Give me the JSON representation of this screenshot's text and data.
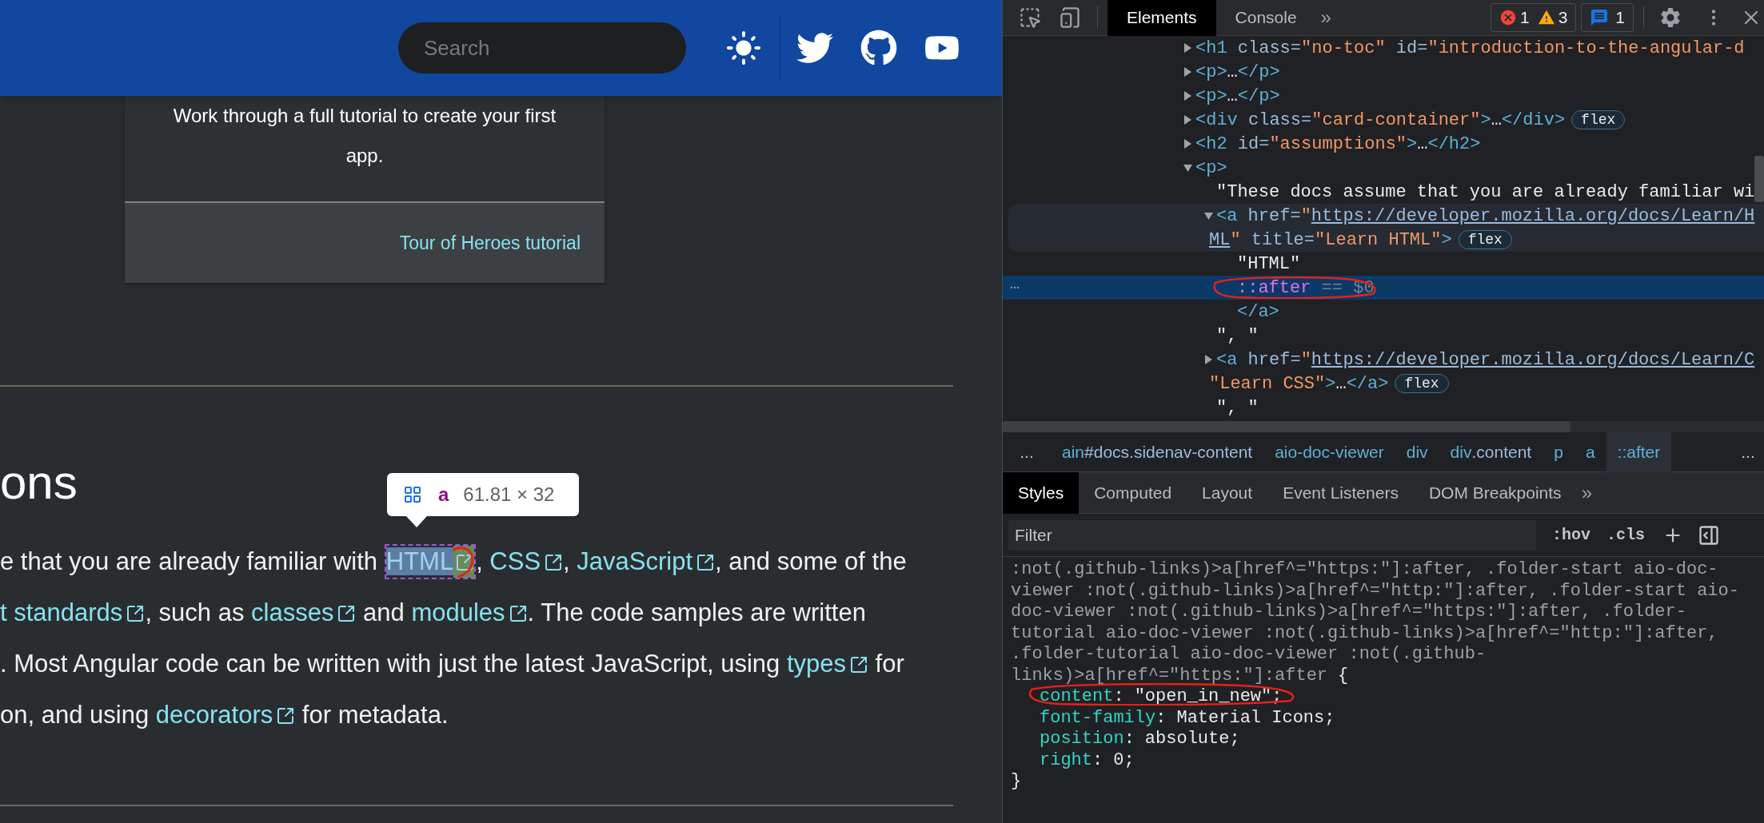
{
  "page": {
    "header": {
      "search": {
        "placeholder": "Search"
      }
    },
    "card": {
      "text": "Work through a full tutorial to create your first app.",
      "link": "Tour of Heroes tutorial"
    },
    "heading": "ons",
    "paragraph": {
      "lines": [
        [
          {
            "kind": "text",
            "text": "e that you are already familiar with "
          },
          {
            "kind": "link",
            "text": "HTML",
            "inspected": true
          },
          {
            "kind": "text",
            "text": ", "
          },
          {
            "kind": "link",
            "text": "CSS",
            "inspected": false
          },
          {
            "kind": "text",
            "text": ", "
          },
          {
            "kind": "link",
            "text": "JavaScript",
            "inspected": false
          },
          {
            "kind": "text",
            "text": ", and some of the"
          }
        ],
        [
          {
            "kind": "link",
            "text": "t standards",
            "inspected": false
          },
          {
            "kind": "text",
            "text": ", such as "
          },
          {
            "kind": "link",
            "text": "classes",
            "inspected": false
          },
          {
            "kind": "text",
            "text": " and "
          },
          {
            "kind": "link",
            "text": "modules",
            "inspected": false
          },
          {
            "kind": "text",
            "text": ". The code samples are written"
          }
        ],
        [
          {
            "kind": "text",
            "text": ". Most Angular code can be written with just the latest JavaScript, using "
          },
          {
            "kind": "link",
            "text": "types",
            "inspected": false
          },
          {
            "kind": "text",
            "text": " for"
          }
        ],
        [
          {
            "kind": "text",
            "text": "on, and using "
          },
          {
            "kind": "link",
            "text": "decorators",
            "inspected": false
          },
          {
            "kind": "text",
            "text": " for metadata."
          }
        ]
      ]
    },
    "inspect_tooltip": {
      "tag": "a",
      "size": "61.81 × 32"
    }
  },
  "devtools": {
    "tabs": [
      {
        "label": "Elements",
        "selected": true
      },
      {
        "label": "Console",
        "selected": false
      }
    ],
    "more": "»",
    "counts": {
      "errors": "1",
      "warnings": "3",
      "messages": "1"
    },
    "dom": [
      {
        "expanded": false,
        "selected": false,
        "hovered": false,
        "lines": [
          [
            {
              "kind": "tag",
              "text": "<h1"
            },
            {
              "kind": "attr",
              "text": " class="
            },
            {
              "kind": "value",
              "text": "\"no-toc\""
            },
            {
              "kind": "attr",
              "text": " id="
            },
            {
              "kind": "value",
              "text": "\"introduction-to-the-angular-d"
            }
          ]
        ]
      },
      {
        "expanded": false,
        "selected": false,
        "hovered": false,
        "lines": [
          [
            {
              "kind": "tag",
              "text": "<p>"
            },
            {
              "kind": "text",
              "text": "…"
            },
            {
              "kind": "tag",
              "text": "</p>"
            }
          ]
        ]
      },
      {
        "expanded": false,
        "selected": false,
        "hovered": false,
        "lines": [
          [
            {
              "kind": "tag",
              "text": "<p>"
            },
            {
              "kind": "text",
              "text": "…"
            },
            {
              "kind": "tag",
              "text": "</p>"
            }
          ]
        ]
      },
      {
        "expanded": false,
        "selected": false,
        "hovered": false,
        "badge": "flex",
        "lines": [
          [
            {
              "kind": "tag",
              "text": "<div"
            },
            {
              "kind": "attr",
              "text": " class="
            },
            {
              "kind": "value",
              "text": "\"card-container\""
            },
            {
              "kind": "tag",
              "text": ">"
            },
            {
              "kind": "text",
              "text": "…"
            },
            {
              "kind": "tag",
              "text": "</div>"
            }
          ]
        ]
      },
      {
        "expanded": false,
        "selected": false,
        "hovered": false,
        "lines": [
          [
            {
              "kind": "tag",
              "text": "<h2"
            },
            {
              "kind": "attr",
              "text": " id="
            },
            {
              "kind": "value",
              "text": "\"assumptions\""
            },
            {
              "kind": "tag",
              "text": ">"
            },
            {
              "kind": "text",
              "text": "…"
            },
            {
              "kind": "tag",
              "text": "</h2>"
            }
          ]
        ]
      },
      {
        "expanded": true,
        "selected": false,
        "hovered": false,
        "lines": [
          [
            {
              "kind": "tag",
              "text": "<p>"
            }
          ]
        ],
        "children": [
          {
            "selected": false,
            "hovered": false,
            "lines": [
              [
                {
                  "kind": "text",
                  "text": "\"These docs assume that you are already familiar wi"
                }
              ]
            ]
          },
          {
            "expanded": true,
            "selected": false,
            "hovered": true,
            "badge": "flex",
            "lines": [
              [
                {
                  "kind": "tag",
                  "text": "<a"
                },
                {
                  "kind": "attr",
                  "text": " href="
                },
                {
                  "kind": "value",
                  "text": "\""
                },
                {
                  "kind": "url",
                  "text": "https://developer.mozilla.org/docs/Learn/H"
                }
              ],
              [
                {
                  "kind": "url",
                  "text": "ML"
                },
                {
                  "kind": "value",
                  "text": "\""
                },
                {
                  "kind": "attr",
                  "text": " title="
                },
                {
                  "kind": "value",
                  "text": "\"Learn HTML\""
                },
                {
                  "kind": "tag",
                  "text": ">"
                }
              ]
            ],
            "children": [
              {
                "selected": false,
                "hovered": false,
                "lines": [
                  [
                    {
                      "kind": "text",
                      "text": "\"HTML\""
                    }
                  ]
                ]
              },
              {
                "selected": true,
                "hovered": false,
                "lines": [
                  [
                    {
                      "kind": "pseudo",
                      "text": "::after"
                    },
                    {
                      "kind": "dim",
                      "text": " == $0"
                    }
                  ]
                ]
              }
            ],
            "closing": [
              {
                "kind": "tag",
                "text": "</a>"
              }
            ]
          },
          {
            "selected": false,
            "hovered": false,
            "lines": [
              [
                {
                  "kind": "text",
                  "text": "\", \""
                }
              ]
            ]
          },
          {
            "expanded": false,
            "selected": false,
            "hovered": false,
            "badge": "flex",
            "lines": [
              [
                {
                  "kind": "tag",
                  "text": "<a"
                },
                {
                  "kind": "attr",
                  "text": " href="
                },
                {
                  "kind": "value",
                  "text": "\""
                },
                {
                  "kind": "url",
                  "text": "https://developer.mozilla.org/docs/Learn/C"
                }
              ],
              [
                {
                  "kind": "value",
                  "text": "\"Learn CSS\""
                },
                {
                  "kind": "tag",
                  "text": ">"
                },
                {
                  "kind": "text",
                  "text": "…"
                },
                {
                  "kind": "tag",
                  "text": "</a>"
                }
              ]
            ]
          },
          {
            "selected": false,
            "hovered": false,
            "lines": [
              [
                {
                  "kind": "text",
                  "text": "\", \""
                }
              ]
            ]
          }
        ]
      }
    ],
    "breadcrumbs": {
      "overflow_left": "...",
      "overflow_right": "...",
      "items": [
        {
          "tag": "ain",
          "suffix": "#docs.sidenav-content",
          "selected": false
        },
        {
          "tag": "aio-doc-viewer",
          "selected": false
        },
        {
          "tag": "div",
          "selected": false
        },
        {
          "tag": "div",
          "suffix": ".content",
          "selected": false
        },
        {
          "tag": "p",
          "selected": false
        },
        {
          "tag": "a",
          "selected": false
        },
        {
          "tag": "::after",
          "selected": true
        }
      ]
    },
    "styles_tabs": [
      {
        "label": "Styles",
        "selected": true
      },
      {
        "label": "Computed",
        "selected": false
      },
      {
        "label": "Layout",
        "selected": false
      },
      {
        "label": "Event Listeners",
        "selected": false
      },
      {
        "label": "DOM Breakpoints",
        "selected": false
      }
    ],
    "styles_more": "»",
    "filter": {
      "placeholder": "Filter",
      "buttons": [
        ":hov",
        ".cls"
      ]
    },
    "rule": {
      "selector_lines": [
        ":not(.github-links)>a[href^=\"https:\"]:after, .folder-start aio-doc-",
        "viewer :not(.github-links)>a[href^=\"http:\"]:after, .folder-start aio-",
        "doc-viewer :not(.github-links)>a[href^=\"https:\"]:after, .folder-",
        "tutorial aio-doc-viewer :not(.github-links)>a[href^=\"http:\"]:after,",
        ".folder-tutorial aio-doc-viewer :not(.github-",
        "links)>a[href^=\"https:\"]:after"
      ],
      "open": "{",
      "separator": ":",
      "declarations": [
        {
          "property": "content",
          "value": "\"open_in_new\";"
        },
        {
          "property": "font-family",
          "value": "Material Icons;"
        },
        {
          "property": "position",
          "value": "absolute;"
        },
        {
          "property": "right",
          "value": "0;"
        }
      ],
      "close": "}"
    }
  }
}
